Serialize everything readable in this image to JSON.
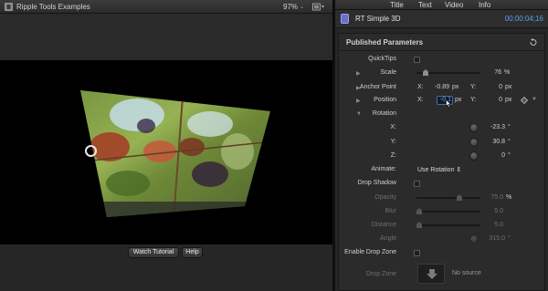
{
  "viewer": {
    "title": "Ripple Tools Examples",
    "zoom": "97%",
    "zoom_caret": "⌄",
    "watch_tutorial_label": "Watch Tutorial",
    "help_label": "Help"
  },
  "inspector": {
    "tabs": [
      "Title",
      "Text",
      "Video",
      "Info"
    ],
    "generator_name": "RT Simple 3D",
    "timecode": "00:00:04;16",
    "section_title": "Published Parameters",
    "params": {
      "quicktips": {
        "label": "QuickTips",
        "checked": false
      },
      "scale": {
        "label": "Scale",
        "value": "76",
        "unit": "%",
        "level_percent": 10
      },
      "anchor_point": {
        "label": "Anchor Point",
        "x_label": "X:",
        "x_value": "-0.89",
        "x_unit": "px",
        "y_label": "Y:",
        "y_value": "0",
        "y_unit": "px"
      },
      "position": {
        "label": "Position",
        "x_label": "X:",
        "x_value": "-0.1",
        "x_unit": "px",
        "y_label": "Y:",
        "y_value": "0",
        "y_unit": "px"
      },
      "rotation": {
        "label": "Rotation"
      },
      "rot_x": {
        "label": "X:",
        "value": "-23.3",
        "unit": "°"
      },
      "rot_y": {
        "label": "Y:",
        "value": "30.8",
        "unit": "°"
      },
      "rot_z": {
        "label": "Z:",
        "value": "0",
        "unit": "°"
      },
      "animate": {
        "label": "Animate:",
        "value": "Use Rotation",
        "caret": "⇕"
      },
      "drop_shadow": {
        "label": "Drop Shadow",
        "checked": false
      },
      "opacity": {
        "label": "Opacity",
        "value": "75.0",
        "unit": "%",
        "level_percent": 75
      },
      "blur": {
        "label": "Blur",
        "value": "5.0",
        "level_percent": 0
      },
      "distance": {
        "label": "Distance",
        "value": "5.0",
        "level_percent": 0
      },
      "angle": {
        "label": "Angle",
        "value": "315.0",
        "unit": "°"
      },
      "enable_drop_zone": {
        "label": "Enable Drop Zone",
        "checked": false
      },
      "drop_zone": {
        "label": "Drop Zone",
        "source": "No source"
      }
    }
  },
  "colors": {
    "accent_blue": "#5aa0f0",
    "background": "#262626",
    "generator_icon": "#6a6fc7"
  },
  "icons": [
    "film-icon",
    "view-options-icon",
    "generator-icon",
    "reset-icon",
    "keyframe-icon",
    "drop-arrow-icon",
    "pointer-cursor-icon",
    "transform-handle-icon"
  ]
}
